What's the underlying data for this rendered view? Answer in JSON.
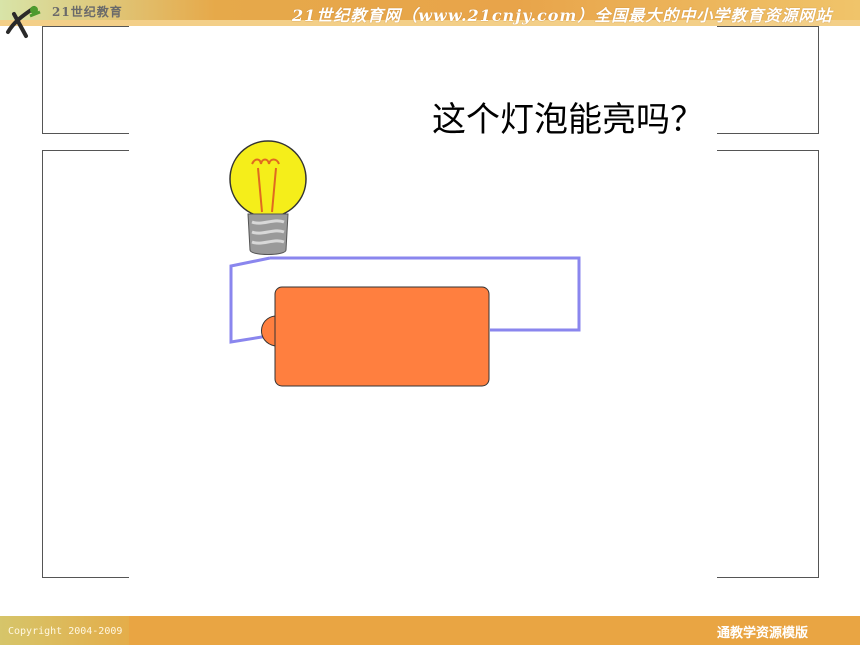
{
  "header": {
    "logo_text": "21世纪教育",
    "site_title": "21世纪教育网（www.21cnjy.com）全国最大的中小学教育资源网站"
  },
  "slide": {
    "question": "这个灯泡能亮吗？",
    "colors": {
      "bulb_glass": "#f5ee1a",
      "bulb_base": "#9a9a9a",
      "wire": "#8a86ee",
      "battery": "#ff7f3f",
      "frame_border": "#555555"
    },
    "icons": [
      "light-bulb-icon",
      "battery-icon",
      "wire-circuit"
    ]
  },
  "footer": {
    "copyright": "Copyright 2004-2009",
    "right_text": "通教学资源模版"
  }
}
